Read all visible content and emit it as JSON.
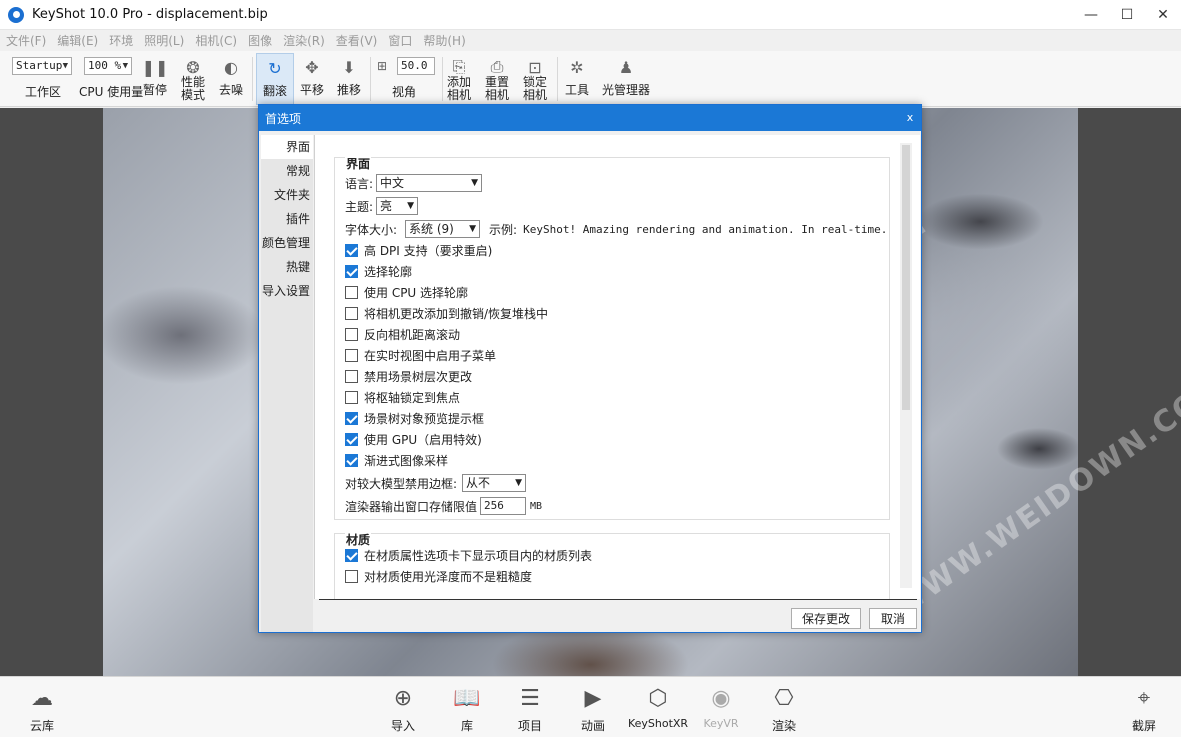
{
  "window": {
    "title": "KeyShot 10.0 Pro  - displacement.bip",
    "minimize": "—",
    "maximize": "☐",
    "close": "✕"
  },
  "menu": [
    "文件(F)",
    "编辑(E)",
    "环境",
    "照明(L)",
    "相机(C)",
    "图像",
    "渲染(R)",
    "查看(V)",
    "窗口",
    "帮助(H)"
  ],
  "toolbar": {
    "workspace_select": "Startup",
    "workspace_label": "工作区",
    "cpu_select": "100 %",
    "cpu_label": "CPU 使用量",
    "pause": "暂停",
    "perf_mode": "性能\n模式",
    "denoise": "去噪",
    "tumble": "翻滚",
    "pan": "平移",
    "dolly": "推移",
    "fov_value": "50.0",
    "fov_label": "视角",
    "add_camera": "添加\n相机",
    "reset_camera": "重置\n相机",
    "lock_camera": "锁定\n相机",
    "tools": "工具",
    "light_manager": "光管理器"
  },
  "watermark": "WWW.WEIDOWN.COM",
  "bottom": {
    "cloud": "云库",
    "import": "导入",
    "library": "库",
    "project": "项目",
    "animation": "动画",
    "keyshotxr": "KeyShotXR",
    "keyvr": "KeyVR",
    "render": "渲染",
    "screenshot": "截屏"
  },
  "dialog": {
    "title": "首选项",
    "close": "x",
    "nav": [
      "界面",
      "常规",
      "文件夹",
      "插件",
      "颜色管理",
      "热键",
      "导入设置"
    ],
    "interface": {
      "title": "界面",
      "language_label": "语言:",
      "language_value": "中文",
      "theme_label": "主题:",
      "theme_value": "亮",
      "fontsize_label": "字体大小:",
      "fontsize_value": "系统 (9)",
      "example_label": "示例:",
      "example_text": "KeyShot! Amazing rendering and animation. In real-time.",
      "checkboxes": [
        {
          "label": "高 DPI 支持（要求重启)",
          "checked": true
        },
        {
          "label": "选择轮廓",
          "checked": true
        },
        {
          "label": "使用 CPU 选择轮廓",
          "checked": false
        },
        {
          "label": "将相机更改添加到撤销/恢复堆栈中",
          "checked": false
        },
        {
          "label": "反向相机距离滚动",
          "checked": false
        },
        {
          "label": "在实时视图中启用子菜单",
          "checked": false
        },
        {
          "label": "禁用场景树层次更改",
          "checked": false
        },
        {
          "label": "将枢轴锁定到焦点",
          "checked": false
        },
        {
          "label": "场景树对象预览提示框",
          "checked": true
        },
        {
          "label": "使用 GPU（启用特效)",
          "checked": true
        },
        {
          "label": "渐进式图像采样",
          "checked": true
        }
      ],
      "bbox_label": "对较大模型禁用边框:",
      "bbox_value": "从不",
      "mem_label": "渲染器输出窗口存储限值",
      "mem_value": "256",
      "mem_unit": "MB"
    },
    "materials": {
      "title": "材质",
      "checkboxes": [
        {
          "label": "在材质属性选项卡下显示项目内的材质列表",
          "checked": true
        },
        {
          "label": "对材质使用光泽度而不是粗糙度",
          "checked": false
        }
      ]
    },
    "save_button": "保存更改",
    "cancel_button": "取消"
  }
}
